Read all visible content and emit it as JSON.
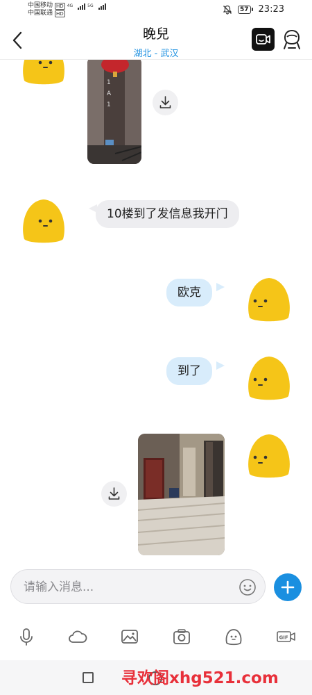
{
  "status_bar": {
    "carrier1": "中国移动",
    "carrier2": "中国联通",
    "hd": "HD",
    "net1": "4G",
    "net2": "5G",
    "battery": "57",
    "time": "23:23"
  },
  "header": {
    "contact_name": "晚兒",
    "contact_location": "湖北 - 武汉"
  },
  "messages": [
    {
      "direction": "incoming",
      "type": "image"
    },
    {
      "direction": "incoming",
      "type": "text",
      "text": "10楼到了发信息我开门"
    },
    {
      "direction": "outgoing",
      "type": "text",
      "text": "欧克"
    },
    {
      "direction": "outgoing",
      "type": "text",
      "text": "到了"
    },
    {
      "direction": "outgoing",
      "type": "image"
    }
  ],
  "composer": {
    "placeholder": "请输入消息..."
  },
  "toolbar": {
    "icons": [
      "microphone-icon",
      "cloud-icon",
      "image-icon",
      "camera-icon",
      "emoji-icon",
      "gif-icon"
    ]
  },
  "watermark": "寻欢阁xhg521.com",
  "colors": {
    "accent": "#1a8fe0",
    "incoming_bubble": "#ededf0",
    "outgoing_bubble": "#d8ecfb",
    "avatar": "#f5c518",
    "watermark": "#e8303a"
  }
}
